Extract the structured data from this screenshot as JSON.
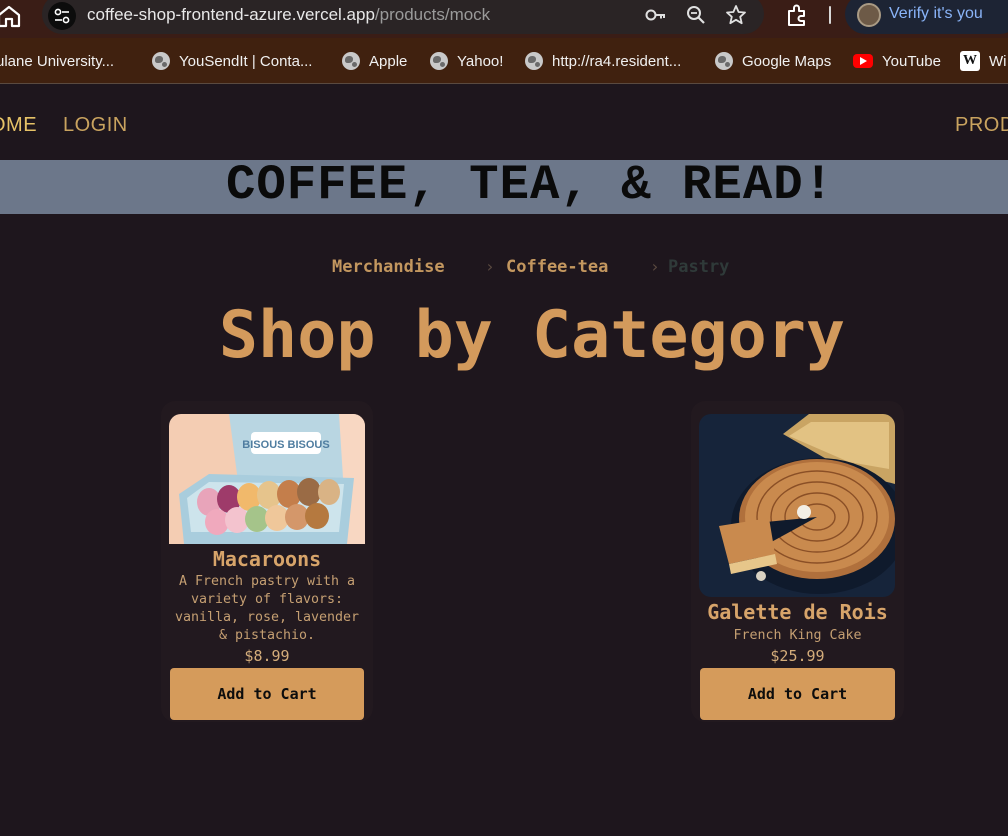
{
  "browser": {
    "url_host": "coffee-shop-frontend-azure.vercel.app",
    "url_path": "/products/mock",
    "profile_label": "Verify it's you",
    "bookmarks": [
      {
        "label": "ulane University...",
        "icon": "tulane-favicon"
      },
      {
        "label": "YouSendIt | Conta...",
        "icon": "globe-icon"
      },
      {
        "label": "Apple",
        "icon": "globe-icon"
      },
      {
        "label": "Yahoo!",
        "icon": "globe-icon"
      },
      {
        "label": "http://ra4.resident...",
        "icon": "globe-icon"
      },
      {
        "label": "Google Maps",
        "icon": "globe-icon"
      },
      {
        "label": "YouTube",
        "icon": "youtube-icon"
      },
      {
        "label": "Wi",
        "icon": "wikipedia-icon"
      }
    ]
  },
  "site": {
    "nav": {
      "home": "OME",
      "login": "LOGIN",
      "products": "PROD"
    },
    "banner_title": "COFFEE, TEA, & READ!",
    "breadcrumbs": [
      {
        "label": "Merchandise",
        "active": true
      },
      {
        "label": "Coffee-tea",
        "active": true
      },
      {
        "label": "Pastry",
        "active": false
      }
    ],
    "separator": "›",
    "heading": "Shop by Category",
    "products": [
      {
        "name": "Macaroons",
        "description": "A French pastry with a variety of flavors: vanilla, rose, lavender & pistachio.",
        "price": "$8.99",
        "button": "Add to Cart",
        "image": "macaroons-box-photo"
      },
      {
        "name": "Galette de Rois",
        "description": "French King Cake",
        "price": "$25.99",
        "button": "Add to Cart",
        "image": "king-cake-photo"
      }
    ]
  },
  "colors": {
    "page_background": "#1e161d",
    "banner_background": "#6c778a",
    "accent": "#d59b5b",
    "nav_active": "#e6c267",
    "link_blue": "#8ab4f8"
  }
}
